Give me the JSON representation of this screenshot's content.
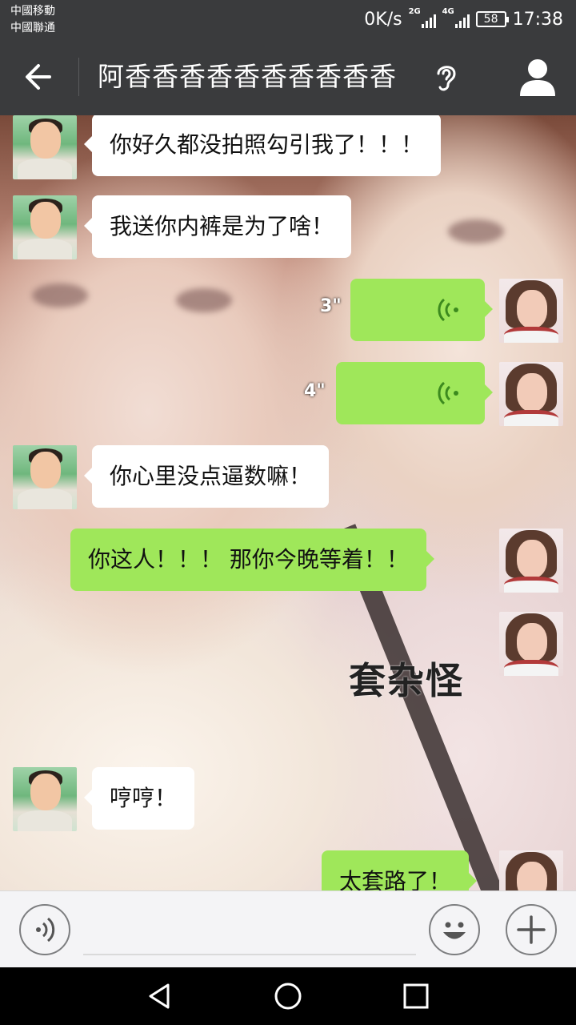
{
  "status_bar": {
    "carrier_1": "中國移動",
    "carrier_2": "中國聯通",
    "net_speed": "0K/s",
    "signal_1_tag": "2G",
    "signal_2_tag": "4G",
    "battery": "58",
    "time": "17:38"
  },
  "header": {
    "title": "阿香香香香香香香香香香",
    "back_icon": "arrow-left-icon",
    "ear_icon": "ear-icon",
    "profile_icon": "person-icon"
  },
  "messages": [
    {
      "side": "left",
      "text": "你好久都没拍照勾引我了！！！"
    },
    {
      "side": "left",
      "text": "我送你内裤是为了啥！"
    },
    {
      "side": "right",
      "type": "voice",
      "duration": "3\""
    },
    {
      "side": "right",
      "type": "voice",
      "duration": "4\""
    },
    {
      "side": "left",
      "text": "你心里没点逼数嘛！"
    },
    {
      "side": "right",
      "text": "你这人！！！ 那你今晚等着！！"
    },
    {
      "side": "right",
      "type": "sticker",
      "text": "套杂怪"
    },
    {
      "side": "left",
      "text": "哼哼！"
    },
    {
      "side": "right",
      "text": "太套路了！"
    }
  ],
  "input_bar": {
    "voice_icon": "voice-toggle-icon",
    "emoji_icon": "smiley-icon",
    "plus_icon": "plus-icon",
    "input_value": ""
  },
  "colors": {
    "bar": "#3a3b3d",
    "bubble_right": "#9fe75a",
    "bubble_left": "#ffffff"
  }
}
